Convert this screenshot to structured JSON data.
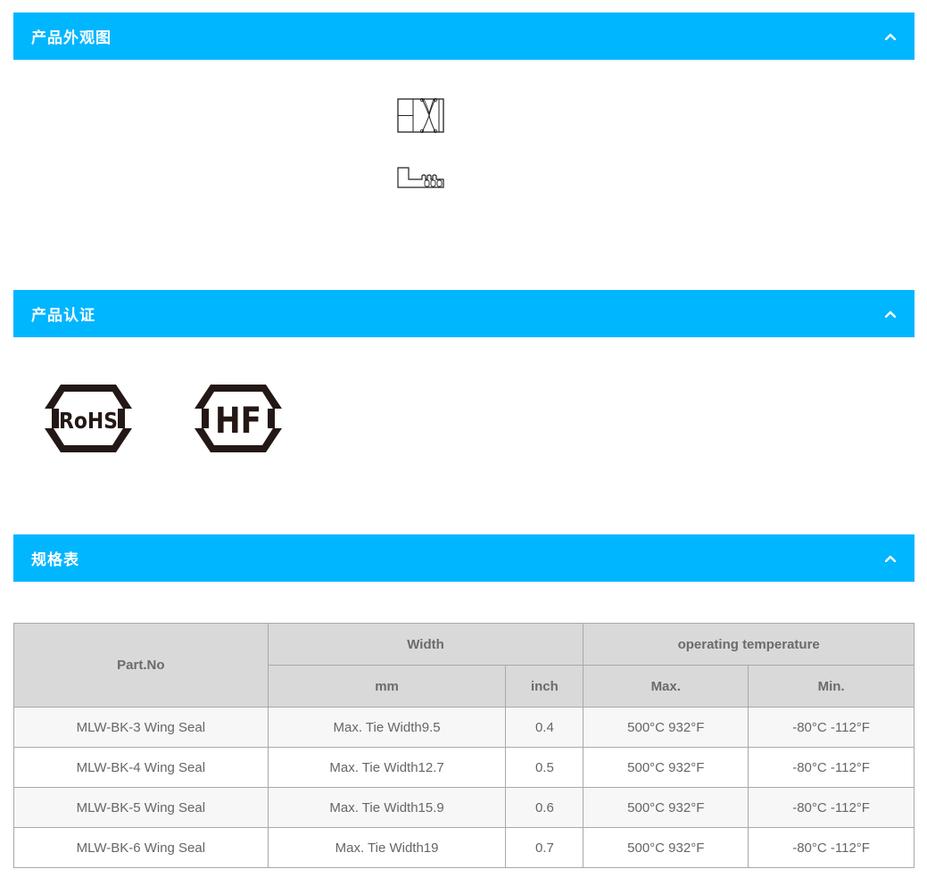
{
  "sections": {
    "appearance": {
      "title": "产品外观图"
    },
    "certification": {
      "title": "产品认证"
    },
    "spec": {
      "title": "规格表"
    }
  },
  "certifications": [
    {
      "text": "RoHS",
      "icon": "rohs-logo"
    },
    {
      "text": "HF",
      "icon": "halogen-free-logo"
    }
  ],
  "colors": {
    "accent": "#00b6ff",
    "table_header": "#d9d9d9",
    "row_alt": "#f7f7f7"
  },
  "table": {
    "headers": {
      "part_no": "Part.No",
      "width": "Width",
      "operating_temperature": "operating temperature",
      "mm": "mm",
      "inch": "inch",
      "max": "Max.",
      "min": "Min."
    },
    "rows": [
      {
        "part": "MLW-BK-3 Wing Seal",
        "mm": "Max. Tie Width9.5",
        "inch": "0.4",
        "max": "500°C 932°F",
        "min": "-80°C -112°F"
      },
      {
        "part": "MLW-BK-4 Wing Seal",
        "mm": "Max. Tie Width12.7",
        "inch": "0.5",
        "max": "500°C 932°F",
        "min": "-80°C -112°F"
      },
      {
        "part": "MLW-BK-5 Wing Seal",
        "mm": "Max. Tie Width15.9",
        "inch": "0.6",
        "max": "500°C 932°F",
        "min": "-80°C -112°F"
      },
      {
        "part": "MLW-BK-6 Wing Seal",
        "mm": "Max. Tie Width19",
        "inch": "0.7",
        "max": "500°C 932°F",
        "min": "-80°C -112°F"
      }
    ]
  }
}
